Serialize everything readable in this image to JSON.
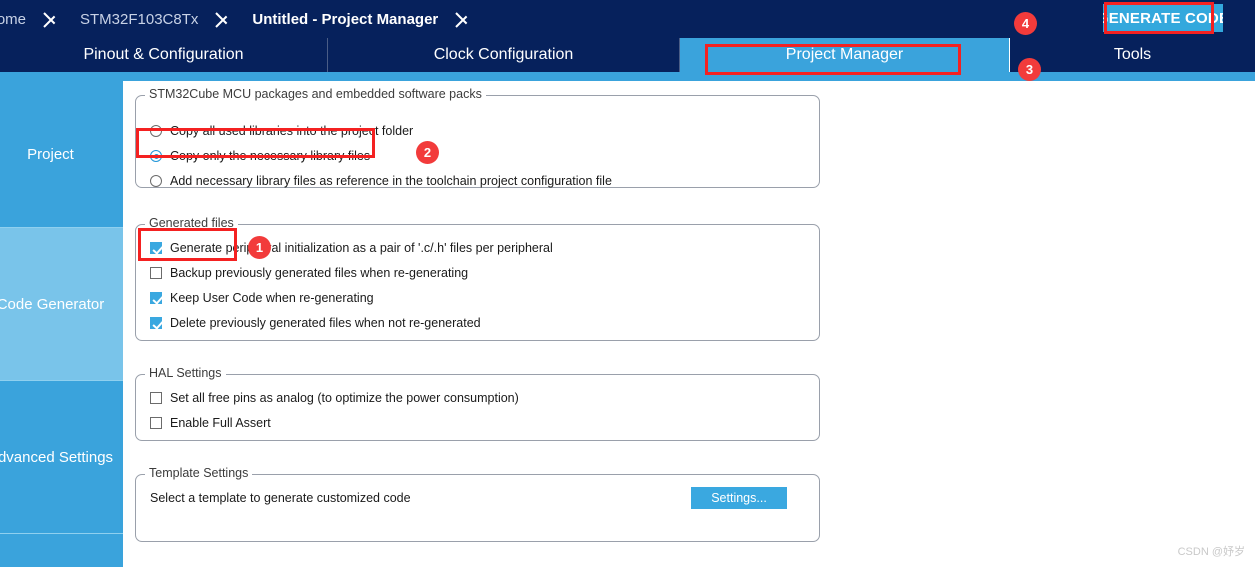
{
  "window": {
    "title": "Untitled - Project Manager"
  },
  "breadcrumb": {
    "items": [
      {
        "label": "Home",
        "current": false
      },
      {
        "label": "STM32F103C8Tx",
        "current": false
      },
      {
        "label": "Untitled - Project Manager",
        "current": true
      }
    ]
  },
  "toolbar": {
    "generate_code_label": "GENERATE CODE"
  },
  "tabs": [
    {
      "label": "Pinout & Configuration",
      "active": false
    },
    {
      "label": "Clock Configuration",
      "active": false
    },
    {
      "label": "Project Manager",
      "active": true
    },
    {
      "label": "Tools",
      "active": false
    }
  ],
  "sidebar": {
    "items": [
      {
        "label": "Project",
        "active": false
      },
      {
        "label": "Code Generator",
        "active": true
      },
      {
        "label": "Advanced Settings",
        "active": false
      }
    ]
  },
  "panels": {
    "mcu_packages": {
      "title": "STM32Cube MCU packages and embedded software packs",
      "options": [
        {
          "label": "Copy all used libraries into the project folder",
          "selected": false
        },
        {
          "label": "Copy only the necessary library files",
          "selected": true
        },
        {
          "label": "Add necessary library files as reference in the toolchain project configuration file",
          "selected": false
        }
      ]
    },
    "generated_files": {
      "title": "Generated files",
      "options": [
        {
          "label": "Generate peripheral initialization as a pair of '.c/.h' files per peripheral",
          "checked": true
        },
        {
          "label": "Backup previously generated files when re-generating",
          "checked": false
        },
        {
          "label": "Keep User Code when re-generating",
          "checked": true
        },
        {
          "label": "Delete previously generated files when not re-generated",
          "checked": true
        }
      ]
    },
    "hal_settings": {
      "title": "HAL Settings",
      "options": [
        {
          "label": "Set all free pins as analog (to optimize the power consumption)",
          "checked": false
        },
        {
          "label": "Enable Full Assert",
          "checked": false
        }
      ]
    },
    "template_settings": {
      "title": "Template Settings",
      "description": "Select a template to generate customized code",
      "settings_button_label": "Settings..."
    }
  },
  "annotations": {
    "badges": [
      {
        "number": "1"
      },
      {
        "number": "2"
      },
      {
        "number": "3"
      },
      {
        "number": "4"
      }
    ],
    "color": "#f42121"
  },
  "watermark": {
    "text": "CSDN @妤岁"
  },
  "colors": {
    "header_navy": "#06215c",
    "accent_blue": "#3aa3dc",
    "active_sidebar": "#79c4ea",
    "annotation_red": "#f42121",
    "checkbox_blue": "#3aa8e0"
  }
}
